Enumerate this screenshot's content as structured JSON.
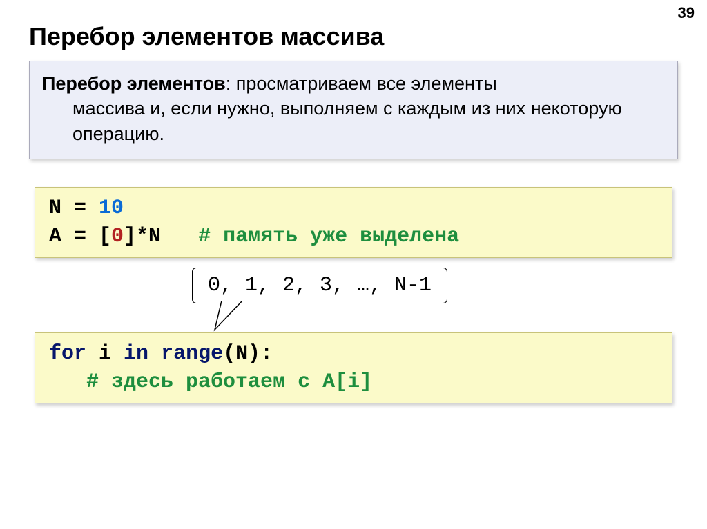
{
  "pageNumber": "39",
  "title": "Перебор элементов массива",
  "definition": {
    "term": "Перебор элементов",
    "line1_rest": ": просматриваем все элементы",
    "line2": "массива и, если нужно, выполняем с каждым из них некоторую операцию."
  },
  "code1": {
    "t1": "N",
    "t2": " = ",
    "t3": "10",
    "t4": "A",
    "t5": " = [",
    "t6": "0",
    "t7": "]*N   ",
    "comment": "# память уже выделена"
  },
  "callout": "0, 1, 2, 3, …, N-1",
  "code2": {
    "t1": "for",
    "t2": " i ",
    "t3": "in",
    "t4": " ",
    "t5": "range",
    "t6": "(N):",
    "indent": "   ",
    "comment": "# здесь работаем с A[i]"
  }
}
